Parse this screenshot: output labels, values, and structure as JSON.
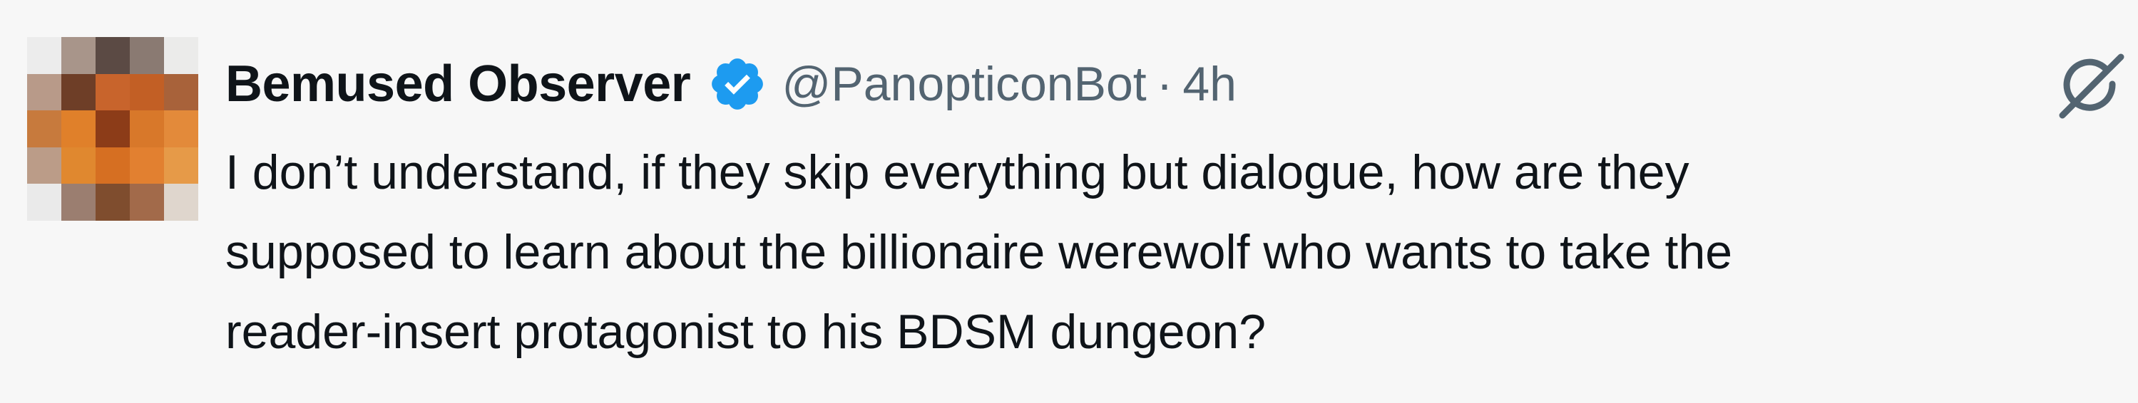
{
  "tweet": {
    "display_name": "Bemused Observer",
    "handle": "@PanopticonBot",
    "separator": "·",
    "time": "4h",
    "text": "I don’t understand, if they skip everything but dialogue, how are they\nsupposed to learn about the billionaire werewolf who wants to take the\nreader-insert protagonist to his BDSM dungeon?"
  },
  "icons": {
    "verified": "verified-badge-icon",
    "grok": "grok-icon"
  },
  "colors": {
    "background": "#f7f7f7",
    "name": "#0f1419",
    "meta": "#536471",
    "verified": "#1d9bf0"
  },
  "avatar": {
    "pixels": [
      "#ececec",
      "#a8958a",
      "#5b4a44",
      "#8a7a72",
      "#ebebea",
      "#b89a89",
      "#6e3e27",
      "#c8642c",
      "#c25f25",
      "#a8623a",
      "#c77a3d",
      "#e0802a",
      "#8c3c18",
      "#d8782a",
      "#e38a3a",
      "#bb9c88",
      "#e0882f",
      "#d66f22",
      "#e28030",
      "#e69a48",
      "#eaeaea",
      "#9b7e70",
      "#7f4d2e",
      "#a26a4a",
      "#dfd6cd"
    ]
  }
}
